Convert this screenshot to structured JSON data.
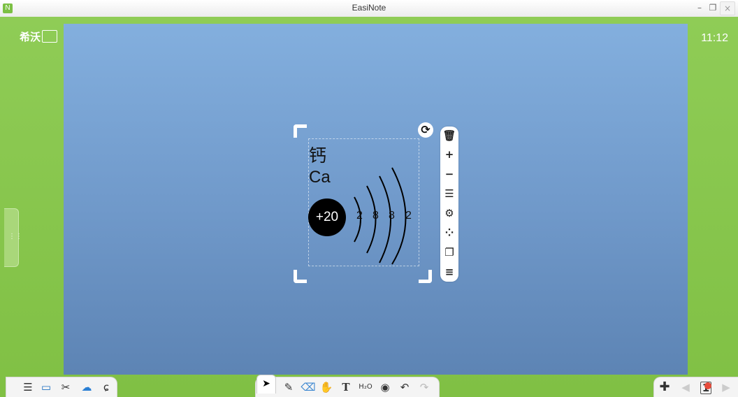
{
  "window": {
    "title": "EasiNote",
    "app_icon": "N",
    "controls": {
      "minimize": "–",
      "restore": "❐",
      "close": "×"
    }
  },
  "header": {
    "logo_text": "希沃",
    "clock": "11:12"
  },
  "object": {
    "chinese_name": "钙",
    "symbol": "Ca",
    "nucleus": "+20",
    "shells": [
      "2",
      "8",
      "8",
      "2"
    ]
  },
  "object_toolbar": [
    {
      "name": "delete-icon",
      "glyph": "🗑"
    },
    {
      "name": "zoom-in-icon",
      "glyph": "+"
    },
    {
      "name": "zoom-out-icon",
      "glyph": "−"
    },
    {
      "name": "text-layout-icon",
      "glyph": "☰"
    },
    {
      "name": "settings-icon",
      "glyph": "⚙"
    },
    {
      "name": "electron-dots-icon",
      "glyph": "⁘"
    },
    {
      "name": "copy-icon",
      "glyph": "❐"
    },
    {
      "name": "more-menu-icon",
      "glyph": "≡"
    }
  ],
  "bottom_left_tools": [
    {
      "name": "menu-icon",
      "glyph": "☰"
    },
    {
      "name": "screen-icon",
      "glyph": "▭"
    },
    {
      "name": "tools-icon",
      "glyph": "✂"
    },
    {
      "name": "cloud-icon",
      "glyph": "☁"
    },
    {
      "name": "handwriting-icon",
      "glyph": "ɕ"
    }
  ],
  "bottom_center_tools": [
    {
      "name": "pen-icon",
      "glyph": "✎"
    },
    {
      "name": "eraser-icon",
      "glyph": "⌫"
    },
    {
      "name": "hand-icon",
      "glyph": "✋"
    },
    {
      "name": "text-icon",
      "glyph": "T"
    },
    {
      "name": "formula-icon",
      "glyph": "H₂O"
    },
    {
      "name": "audio-icon",
      "glyph": "◉"
    },
    {
      "name": "undo-icon",
      "glyph": "↶"
    },
    {
      "name": "redo-icon",
      "glyph": "↷"
    }
  ],
  "bottom_right_tools": [
    {
      "name": "add-page-icon",
      "glyph": "✚"
    },
    {
      "name": "prev-page-icon",
      "glyph": "◀"
    },
    {
      "name": "page-number",
      "glyph": "1"
    },
    {
      "name": "next-page-icon",
      "glyph": "▶"
    }
  ],
  "select_tool_glyph": "➤",
  "colors": {
    "frame": "#8bc34a",
    "canvas_top": "#83afde",
    "canvas_bottom": "#5d84b4"
  }
}
